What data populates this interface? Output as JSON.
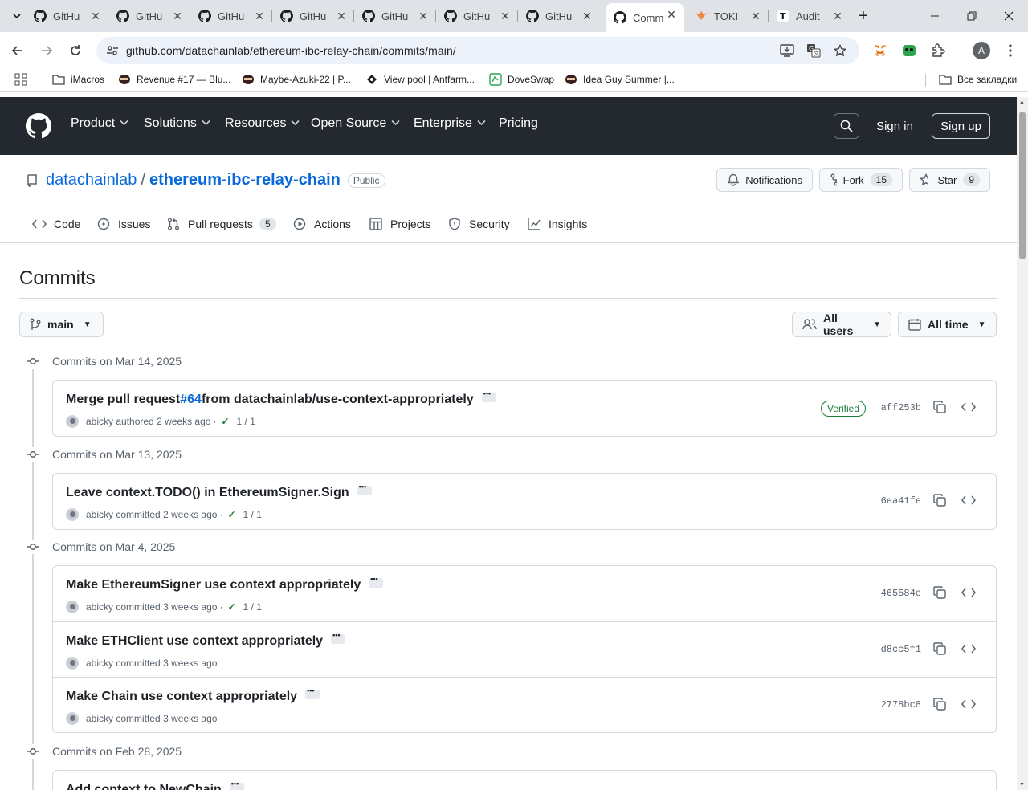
{
  "browser": {
    "tabs": [
      {
        "title": "GitHu",
        "icon": "github-icon"
      },
      {
        "title": "GitHu",
        "icon": "github-icon"
      },
      {
        "title": "GitHu",
        "icon": "github-icon"
      },
      {
        "title": "GitHu",
        "icon": "github-icon"
      },
      {
        "title": "GitHu",
        "icon": "github-icon"
      },
      {
        "title": "GitHu",
        "icon": "github-icon"
      },
      {
        "title": "GitHu",
        "icon": "github-icon"
      },
      {
        "title": "Comm",
        "icon": "github-icon",
        "active": true
      },
      {
        "title": "TOKI",
        "icon": "toki-icon"
      },
      {
        "title": "Audit",
        "icon": "t-icon"
      }
    ],
    "url": "github.com/datachainlab/ethereum-ibc-relay-chain/commits/main/",
    "profile_initial": "A",
    "bookmarks": [
      "iMacros",
      "Revenue #17 — Blu...",
      "Maybe-Azuki-22 | P...",
      "View pool | Antfarm...",
      "DoveSwap",
      "Idea Guy Summer |..."
    ],
    "all_bookmarks": "Все закладки"
  },
  "gh": {
    "nav": [
      "Product",
      "Solutions",
      "Resources",
      "Open Source",
      "Enterprise",
      "Pricing"
    ],
    "sign_in": "Sign in",
    "sign_up": "Sign up"
  },
  "repo": {
    "owner": "datachainlab",
    "sep": "/",
    "name": "ethereum-ibc-relay-chain",
    "visibility": "Public",
    "notifications": "Notifications",
    "fork": "Fork",
    "fork_count": "15",
    "star": "Star",
    "star_count": "9",
    "tabs": [
      {
        "label": "Code",
        "icon": "code-icon"
      },
      {
        "label": "Issues",
        "icon": "issue-icon"
      },
      {
        "label": "Pull requests",
        "icon": "pull-request-icon",
        "count": "5"
      },
      {
        "label": "Actions",
        "icon": "play-icon"
      },
      {
        "label": "Projects",
        "icon": "table-icon"
      },
      {
        "label": "Security",
        "icon": "shield-icon"
      },
      {
        "label": "Insights",
        "icon": "graph-icon"
      }
    ]
  },
  "page": {
    "title": "Commits",
    "branch": "main",
    "users": "All users",
    "time": "All time"
  },
  "groups": [
    {
      "date": "Commits on Mar 14, 2025",
      "commits": [
        {
          "prefix": "Merge pull request ",
          "link": "#64",
          "suffix": " from datachainlab/use-context-appropriately",
          "author": "abicky",
          "action": "authored",
          "ago": "2 weeks ago",
          "checks": "1 / 1",
          "verified": "Verified",
          "sha": "aff253b"
        }
      ]
    },
    {
      "date": "Commits on Mar 13, 2025",
      "commits": [
        {
          "prefix": "Leave context.TODO() in EthereumSigner.Sign",
          "author": "abicky",
          "action": "committed",
          "ago": "2 weeks ago",
          "checks": "1 / 1",
          "sha": "6ea41fe"
        }
      ]
    },
    {
      "date": "Commits on Mar 4, 2025",
      "commits": [
        {
          "prefix": "Make EthereumSigner use context appropriately",
          "author": "abicky",
          "action": "committed",
          "ago": "3 weeks ago",
          "checks": "1 / 1",
          "sha": "465584e"
        },
        {
          "prefix": "Make ETHClient use context appropriately",
          "author": "abicky",
          "action": "committed",
          "ago": "3 weeks ago",
          "sha": "d8cc5f1"
        },
        {
          "prefix": "Make Chain use context appropriately",
          "author": "abicky",
          "action": "committed",
          "ago": "3 weeks ago",
          "sha": "2778bc8"
        }
      ]
    },
    {
      "date": "Commits on Feb 28, 2025",
      "commits": [
        {
          "prefix": "Add context to NewChain"
        }
      ]
    }
  ]
}
